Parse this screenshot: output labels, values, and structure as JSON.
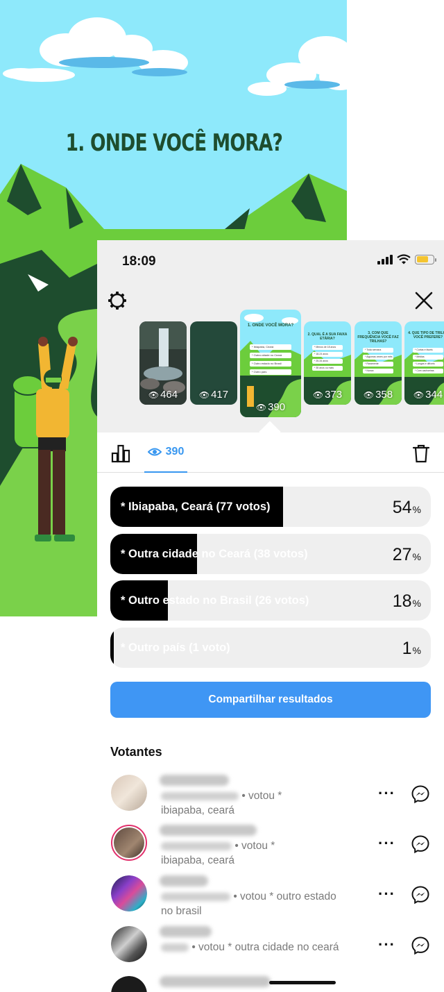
{
  "story": {
    "title": "1. ONDE VOCÊ MORA?"
  },
  "status_bar": {
    "time": "18:09"
  },
  "thumbnails": [
    {
      "views": "464",
      "kind": "waterfall-photo"
    },
    {
      "views": "417",
      "kind": "dark-green"
    },
    {
      "views": "390",
      "kind": "question-1",
      "selected": true,
      "mini_title": "1. ONDE VOCÊ MORA?",
      "mini_options": [
        "* Ibiapaba, Ceará",
        "* Outra cidade no Ceará",
        "* Outro estado no Brasil",
        "* Outro país"
      ]
    },
    {
      "views": "373",
      "kind": "question-2",
      "mini_title": "2. QUAL É A SUA FAIXA ETÁRIA?",
      "mini_options": [
        "* Menos de 18 anos",
        "* 18-24 anos",
        "* 25-34 anos",
        "* 35 anos ou mais"
      ]
    },
    {
      "views": "358",
      "kind": "question-3",
      "mini_title": "3. COM QUE FREQUÊNCIA VOCÊ FAZ TRILHAS?",
      "mini_options": [
        "* Toda semana",
        "* Algumas vezes por mês",
        "* Raramente",
        "* Nunca"
      ]
    },
    {
      "views": "344",
      "kind": "question-4",
      "mini_title": "4. QUE TIPO DE TRILHA VOCÊ PREFERE?",
      "mini_options": [
        "* Curtas e fáceis",
        "* Médias",
        "* Longas e difíceis",
        "* Com cachoeiras"
      ]
    }
  ],
  "tabs": {
    "views_count": "390"
  },
  "poll": [
    {
      "label": "* Ibiapaba, Ceará (77 votos)",
      "percent": 54,
      "percent_text": "54",
      "unit": "%"
    },
    {
      "label": "* Outra cidade no Ceará (38 votos)",
      "percent": 27,
      "percent_text": "27",
      "unit": "%"
    },
    {
      "label": "* Outro estado no Brasil (26 votos)",
      "percent": 18,
      "percent_text": "18",
      "unit": "%"
    },
    {
      "label": "* Outro país (1 voto)",
      "percent": 1,
      "percent_text": "1",
      "unit": "%"
    }
  ],
  "share_button": "Compartilhar resultados",
  "voters_title": "Votantes",
  "voters": [
    {
      "line1": "• votou *",
      "line2": "ibiapaba, ceará"
    },
    {
      "line1": "• votou *",
      "line2": "ibiapaba, ceará"
    },
    {
      "line1": "• votou * outro estado",
      "line2": "no brasil"
    },
    {
      "line1": "• votou * outra cidade no ceará",
      "line2": ""
    }
  ],
  "colors": {
    "accent_blue": "#3897f0",
    "share_button": "#3f96f4",
    "sky": "#8ee9fb",
    "mountain_green": "#6ccd3c",
    "forest_dark": "#1e4d2e",
    "story_ring": "#e1306c"
  }
}
